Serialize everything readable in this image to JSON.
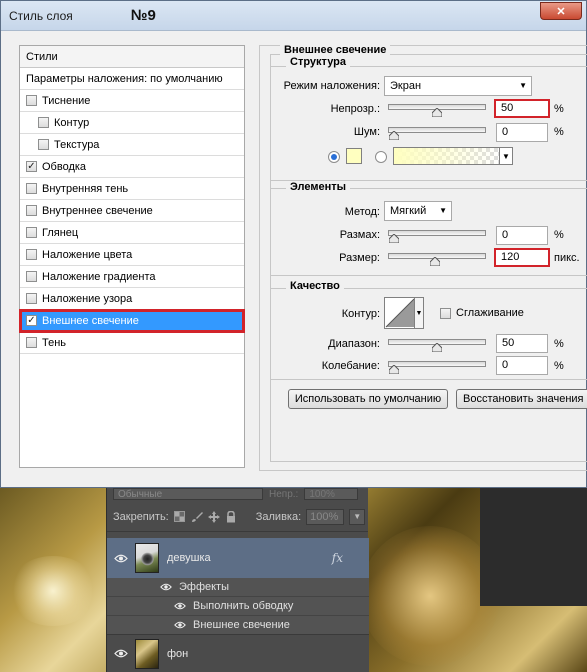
{
  "dialog": {
    "title": "Стиль слоя",
    "number_label": "№9",
    "close_icon": "close-icon"
  },
  "styles": {
    "header": "Стили",
    "blending_options": "Параметры наложения: по умолчанию",
    "items": [
      {
        "label": "Тиснение",
        "checked": false,
        "indent": false
      },
      {
        "label": "Контур",
        "checked": false,
        "indent": true
      },
      {
        "label": "Текстура",
        "checked": false,
        "indent": true
      },
      {
        "label": "Обводка",
        "checked": true,
        "indent": false
      },
      {
        "label": "Внутренняя тень",
        "checked": false,
        "indent": false
      },
      {
        "label": "Внутреннее свечение",
        "checked": false,
        "indent": false
      },
      {
        "label": "Глянец",
        "checked": false,
        "indent": false
      },
      {
        "label": "Наложение цвета",
        "checked": false,
        "indent": false
      },
      {
        "label": "Наложение градиента",
        "checked": false,
        "indent": false
      },
      {
        "label": "Наложение узора",
        "checked": false,
        "indent": false
      },
      {
        "label": "Внешнее свечение",
        "checked": true,
        "indent": false,
        "selected": true
      },
      {
        "label": "Тень",
        "checked": false,
        "indent": false
      }
    ]
  },
  "outer_glow": {
    "title": "Внешнее свечение",
    "structure": {
      "title": "Структура",
      "blend_mode_label": "Режим наложения:",
      "blend_mode_value": "Экран",
      "opacity_label": "Непрозр.:",
      "opacity_value": "50",
      "opacity_fraction": 0.5,
      "noise_label": "Шум:",
      "noise_value": "0",
      "noise_fraction": 0,
      "percent": "%",
      "glow_color": "#ffffc0"
    },
    "elements": {
      "title": "Элементы",
      "technique_label": "Метод:",
      "technique_value": "Мягкий",
      "spread_label": "Размах:",
      "spread_value": "0",
      "spread_fraction": 0,
      "size_label": "Размер:",
      "size_value": "120",
      "size_fraction": 0.48,
      "size_unit": "пикс.",
      "percent": "%"
    },
    "quality": {
      "title": "Качество",
      "contour_label": "Контур:",
      "antialias_label": "Сглаживание",
      "antialias_checked": false,
      "range_label": "Диапазон:",
      "range_value": "50",
      "range_fraction": 0.5,
      "jitter_label": "Колебание:",
      "jitter_value": "0",
      "jitter_fraction": 0,
      "percent": "%"
    },
    "buttons": {
      "make_default": "Использовать по умолчанию",
      "reset_default": "Восстановить значения по умолчанию"
    }
  },
  "layers_panel": {
    "blend_mode": "Обычные",
    "opacity_label": "Непр.:",
    "opacity_value": "100%",
    "lock_label": "Закрепить:",
    "fill_label": "Заливка:",
    "fill_value": "100%",
    "layers": [
      {
        "name": "девушка",
        "has_fx": true,
        "fx_label": "fx"
      },
      {
        "name": "фон",
        "has_fx": false
      }
    ],
    "effects_label": "Эффекты",
    "effects": [
      "Выполнить обводку",
      "Внешнее свечение"
    ]
  }
}
